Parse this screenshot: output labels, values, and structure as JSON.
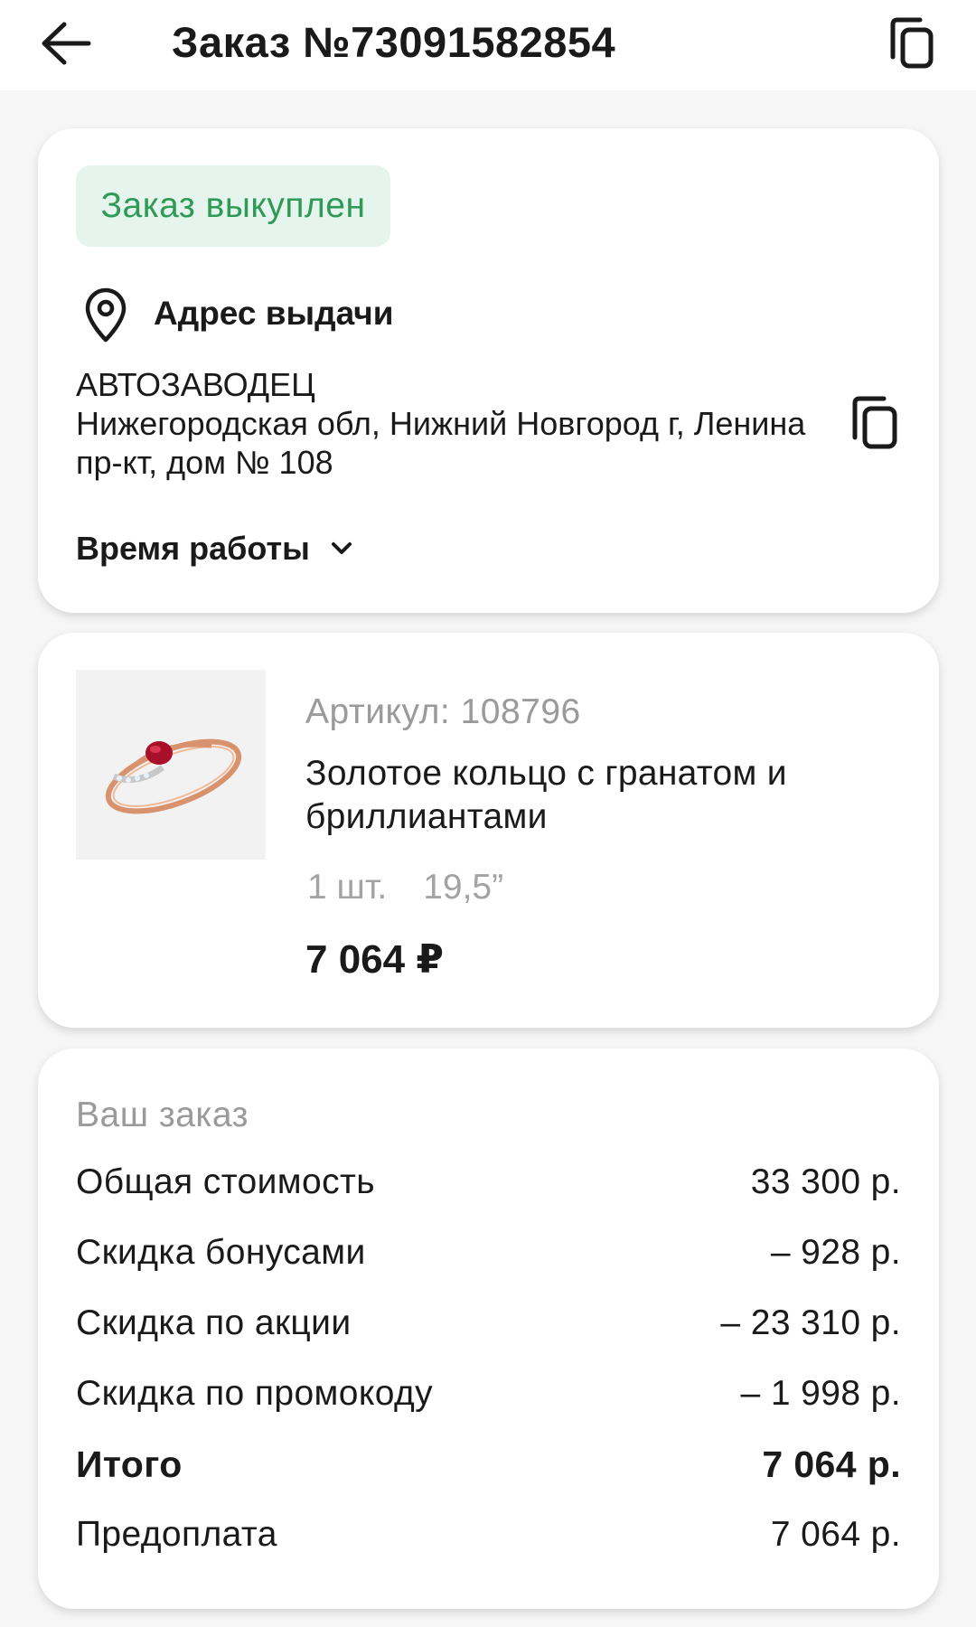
{
  "header": {
    "title": "Заказ №73091582854",
    "back_icon": "arrow-left-icon",
    "copy_icon": "copy-icon"
  },
  "status": {
    "label": "Заказ выкуплен",
    "bg_color": "#e5f4ec",
    "text_color": "#2f9a55"
  },
  "pickup": {
    "heading": "Адрес выдачи",
    "icon": "map-pin-icon",
    "name": "АВТОЗАВОДЕЦ",
    "address_line1": "Нижегородская обл, Нижний Новгород г, Ленина",
    "address_line2": "пр-кт, дом № 108",
    "copy_icon": "copy-icon",
    "hours_label": "Время работы",
    "hours_icon": "chevron-down-icon"
  },
  "product": {
    "article": "Артикул: 108796",
    "name": "Золотое кольцо с гранатом и бриллиантами",
    "quantity": "1 шт.",
    "size": "19,5”",
    "price": "7 064 ₽",
    "image": "gold-ring-garnet-image"
  },
  "summary": {
    "heading": "Ваш заказ",
    "rows": [
      {
        "label": "Общая стоимость",
        "value": "33 300 р."
      },
      {
        "label": "Скидка бонусами",
        "value": "– 928 р."
      },
      {
        "label": "Скидка по акции",
        "value": "– 23 310 р."
      },
      {
        "label": "Скидка по промокоду",
        "value": "– 1 998 р."
      },
      {
        "label": "Итого",
        "value": "7 064 р."
      },
      {
        "label": "Предоплата",
        "value": "7 064 р."
      }
    ]
  }
}
